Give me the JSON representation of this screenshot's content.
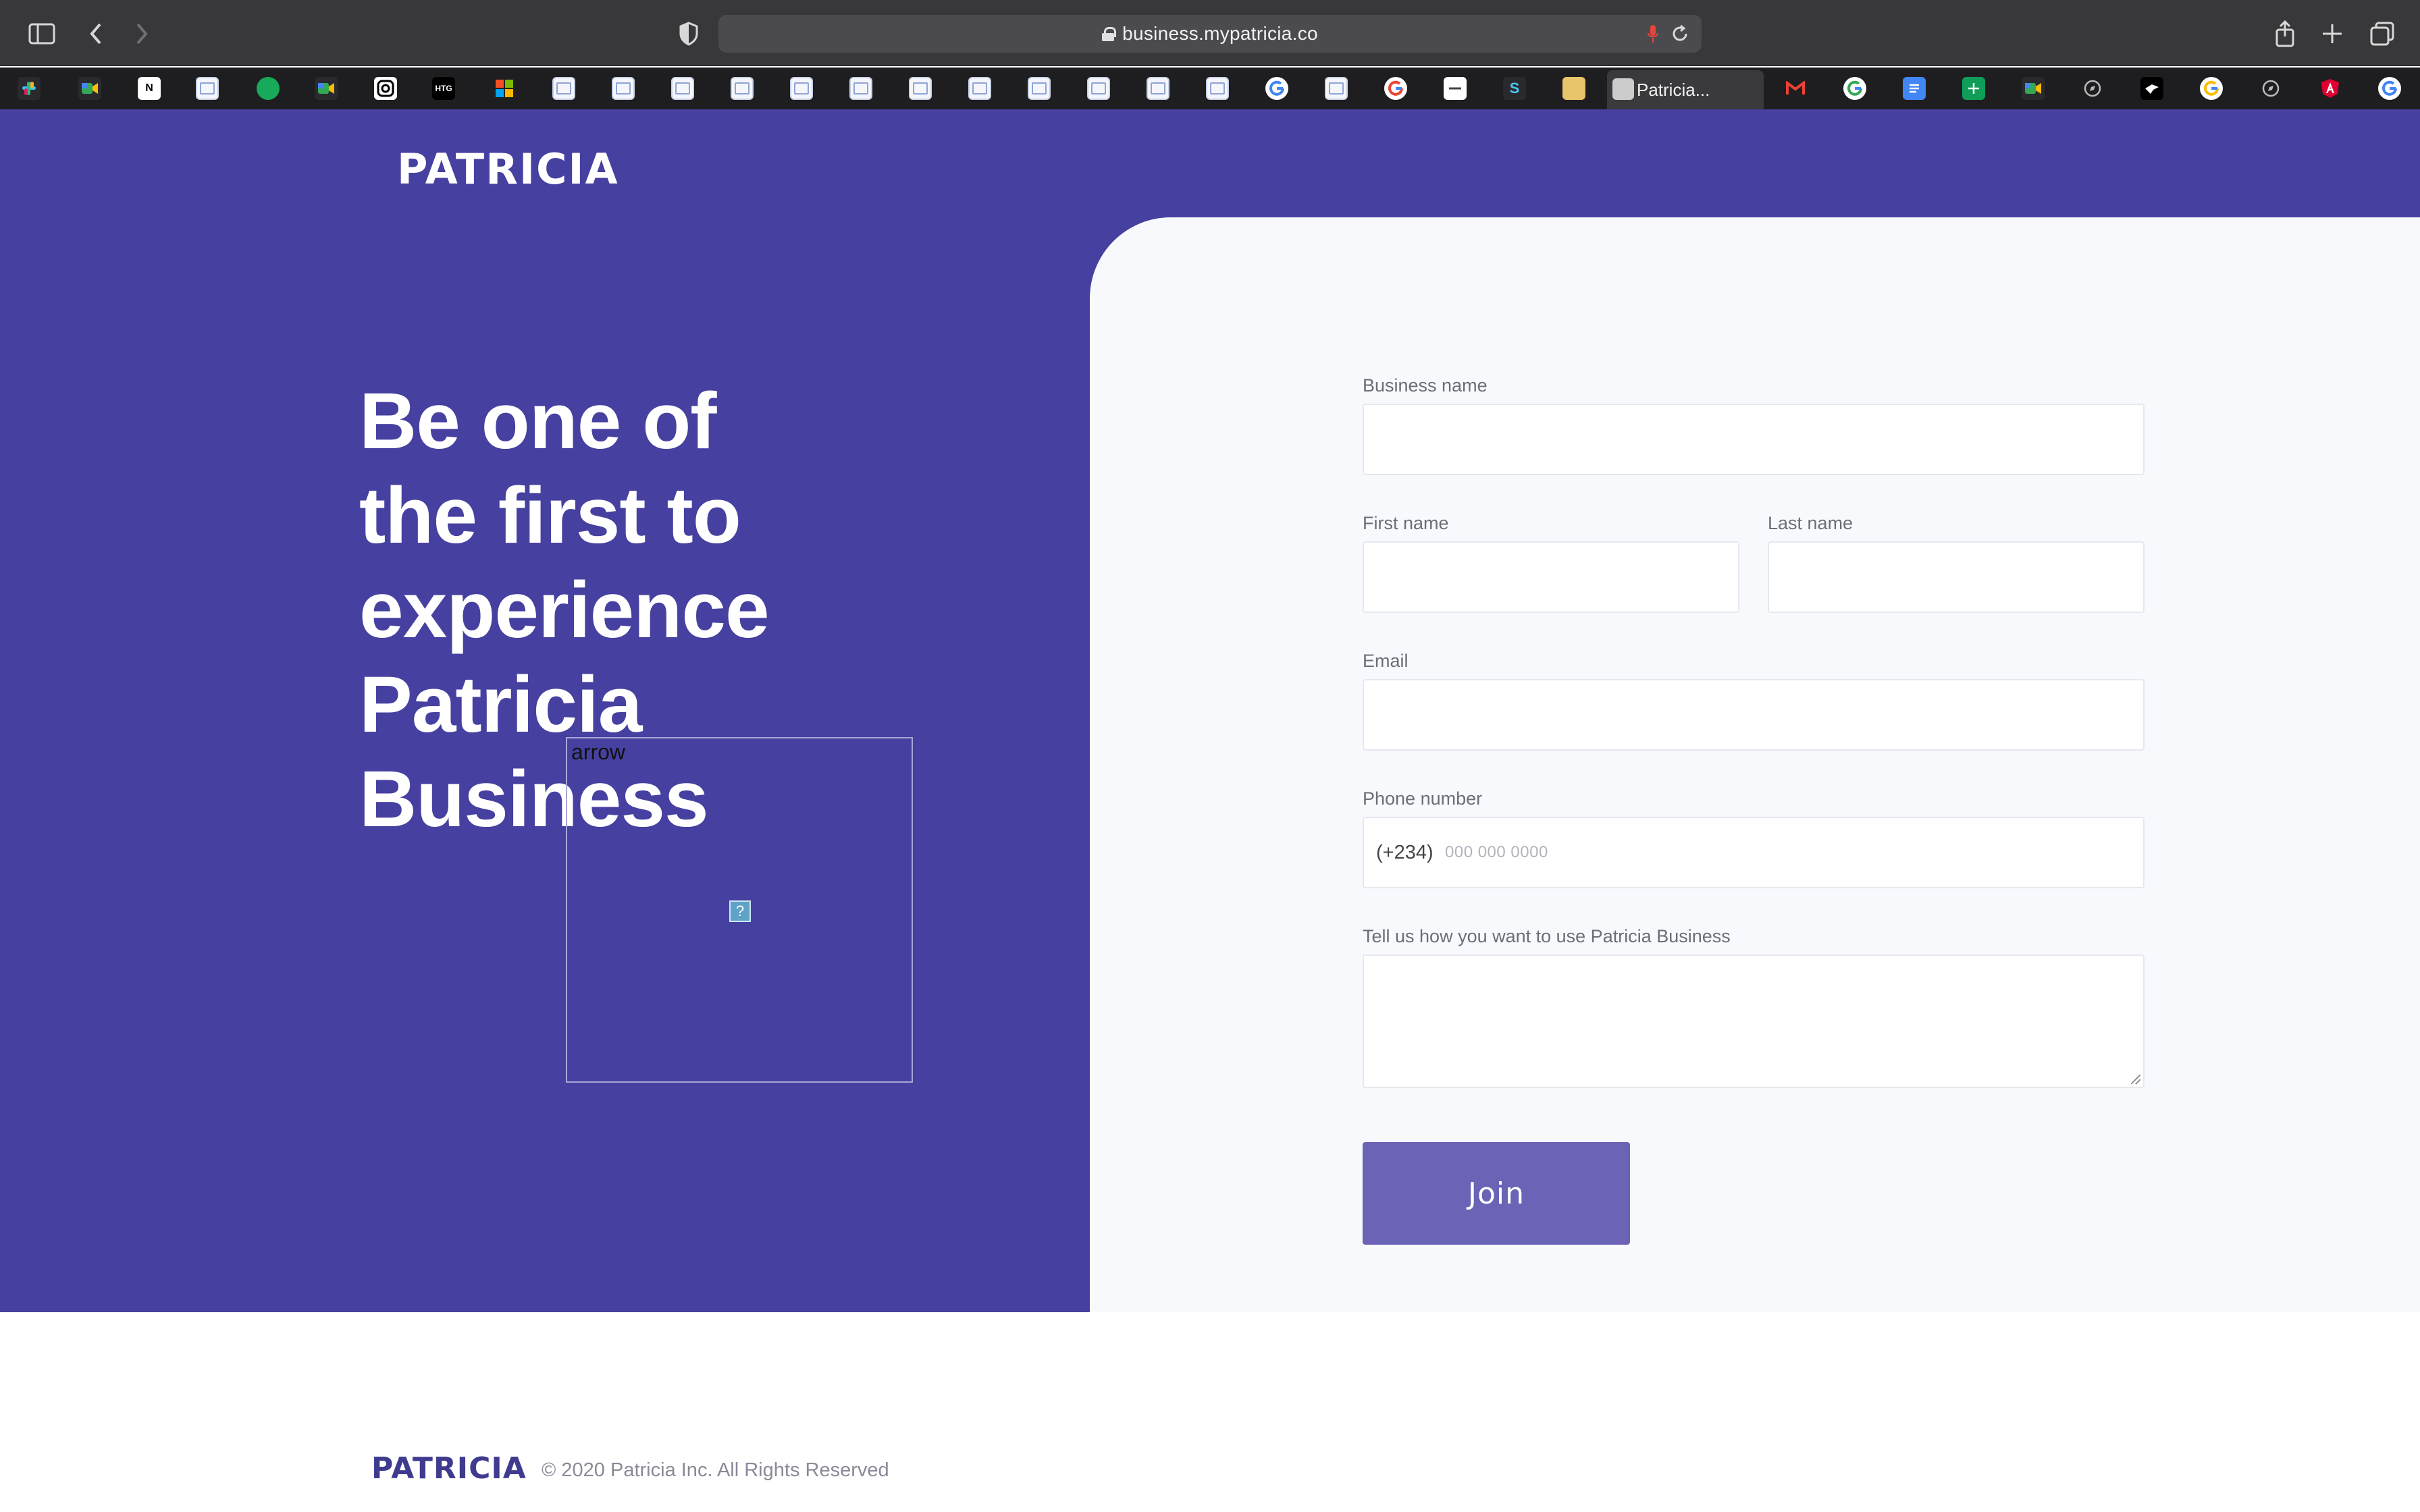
{
  "browser": {
    "url": "business.mypatricia.co",
    "active_tab_title": "Patricia...",
    "favicons": [
      "slack-icon",
      "meet-icon",
      "notion-icon",
      "doc-icon",
      "zoho-icon",
      "meet-icon",
      "instagram-icon",
      "htg-icon",
      "microsoft-icon",
      "doc-icon",
      "doc-icon",
      "doc-icon",
      "doc-icon",
      "doc-icon",
      "doc-icon",
      "doc-icon",
      "doc-icon",
      "doc-icon",
      "doc-icon",
      "doc-icon",
      "google-icon",
      "doc-icon",
      "google-icon",
      "minus-icon",
      "stack-icon",
      "folder-icon",
      "gmail-icon",
      "google-icon",
      "docs-icon",
      "sheets-icon",
      "meet-icon",
      "compass-icon",
      "bird-icon",
      "google-icon",
      "compass-icon",
      "angular-icon",
      "google-icon"
    ],
    "htg_label": "HTG"
  },
  "hero": {
    "logo_text": "PATRICIA",
    "headline_lines": [
      "Be one of",
      "the first to",
      "experience",
      "Patricia",
      "Business"
    ],
    "broken_image_alt": "arrow",
    "broken_image_glyph": "?"
  },
  "form": {
    "business_name_label": "Business name",
    "first_name_label": "First name",
    "last_name_label": "Last name",
    "email_label": "Email",
    "phone_label": "Phone number",
    "phone_prefix": "(+234)",
    "phone_placeholder": "000 000 0000",
    "usage_label": "Tell us how you want to use Patricia Business",
    "join_label": "Join"
  },
  "footer": {
    "logo_text": "PATRICIA",
    "copyright": "© 2020 Patricia Inc. All Rights Reserved"
  },
  "colors": {
    "brand_purple": "#4640a0",
    "button_purple": "#6b63b6",
    "panel_bg": "#f8f9fd"
  }
}
